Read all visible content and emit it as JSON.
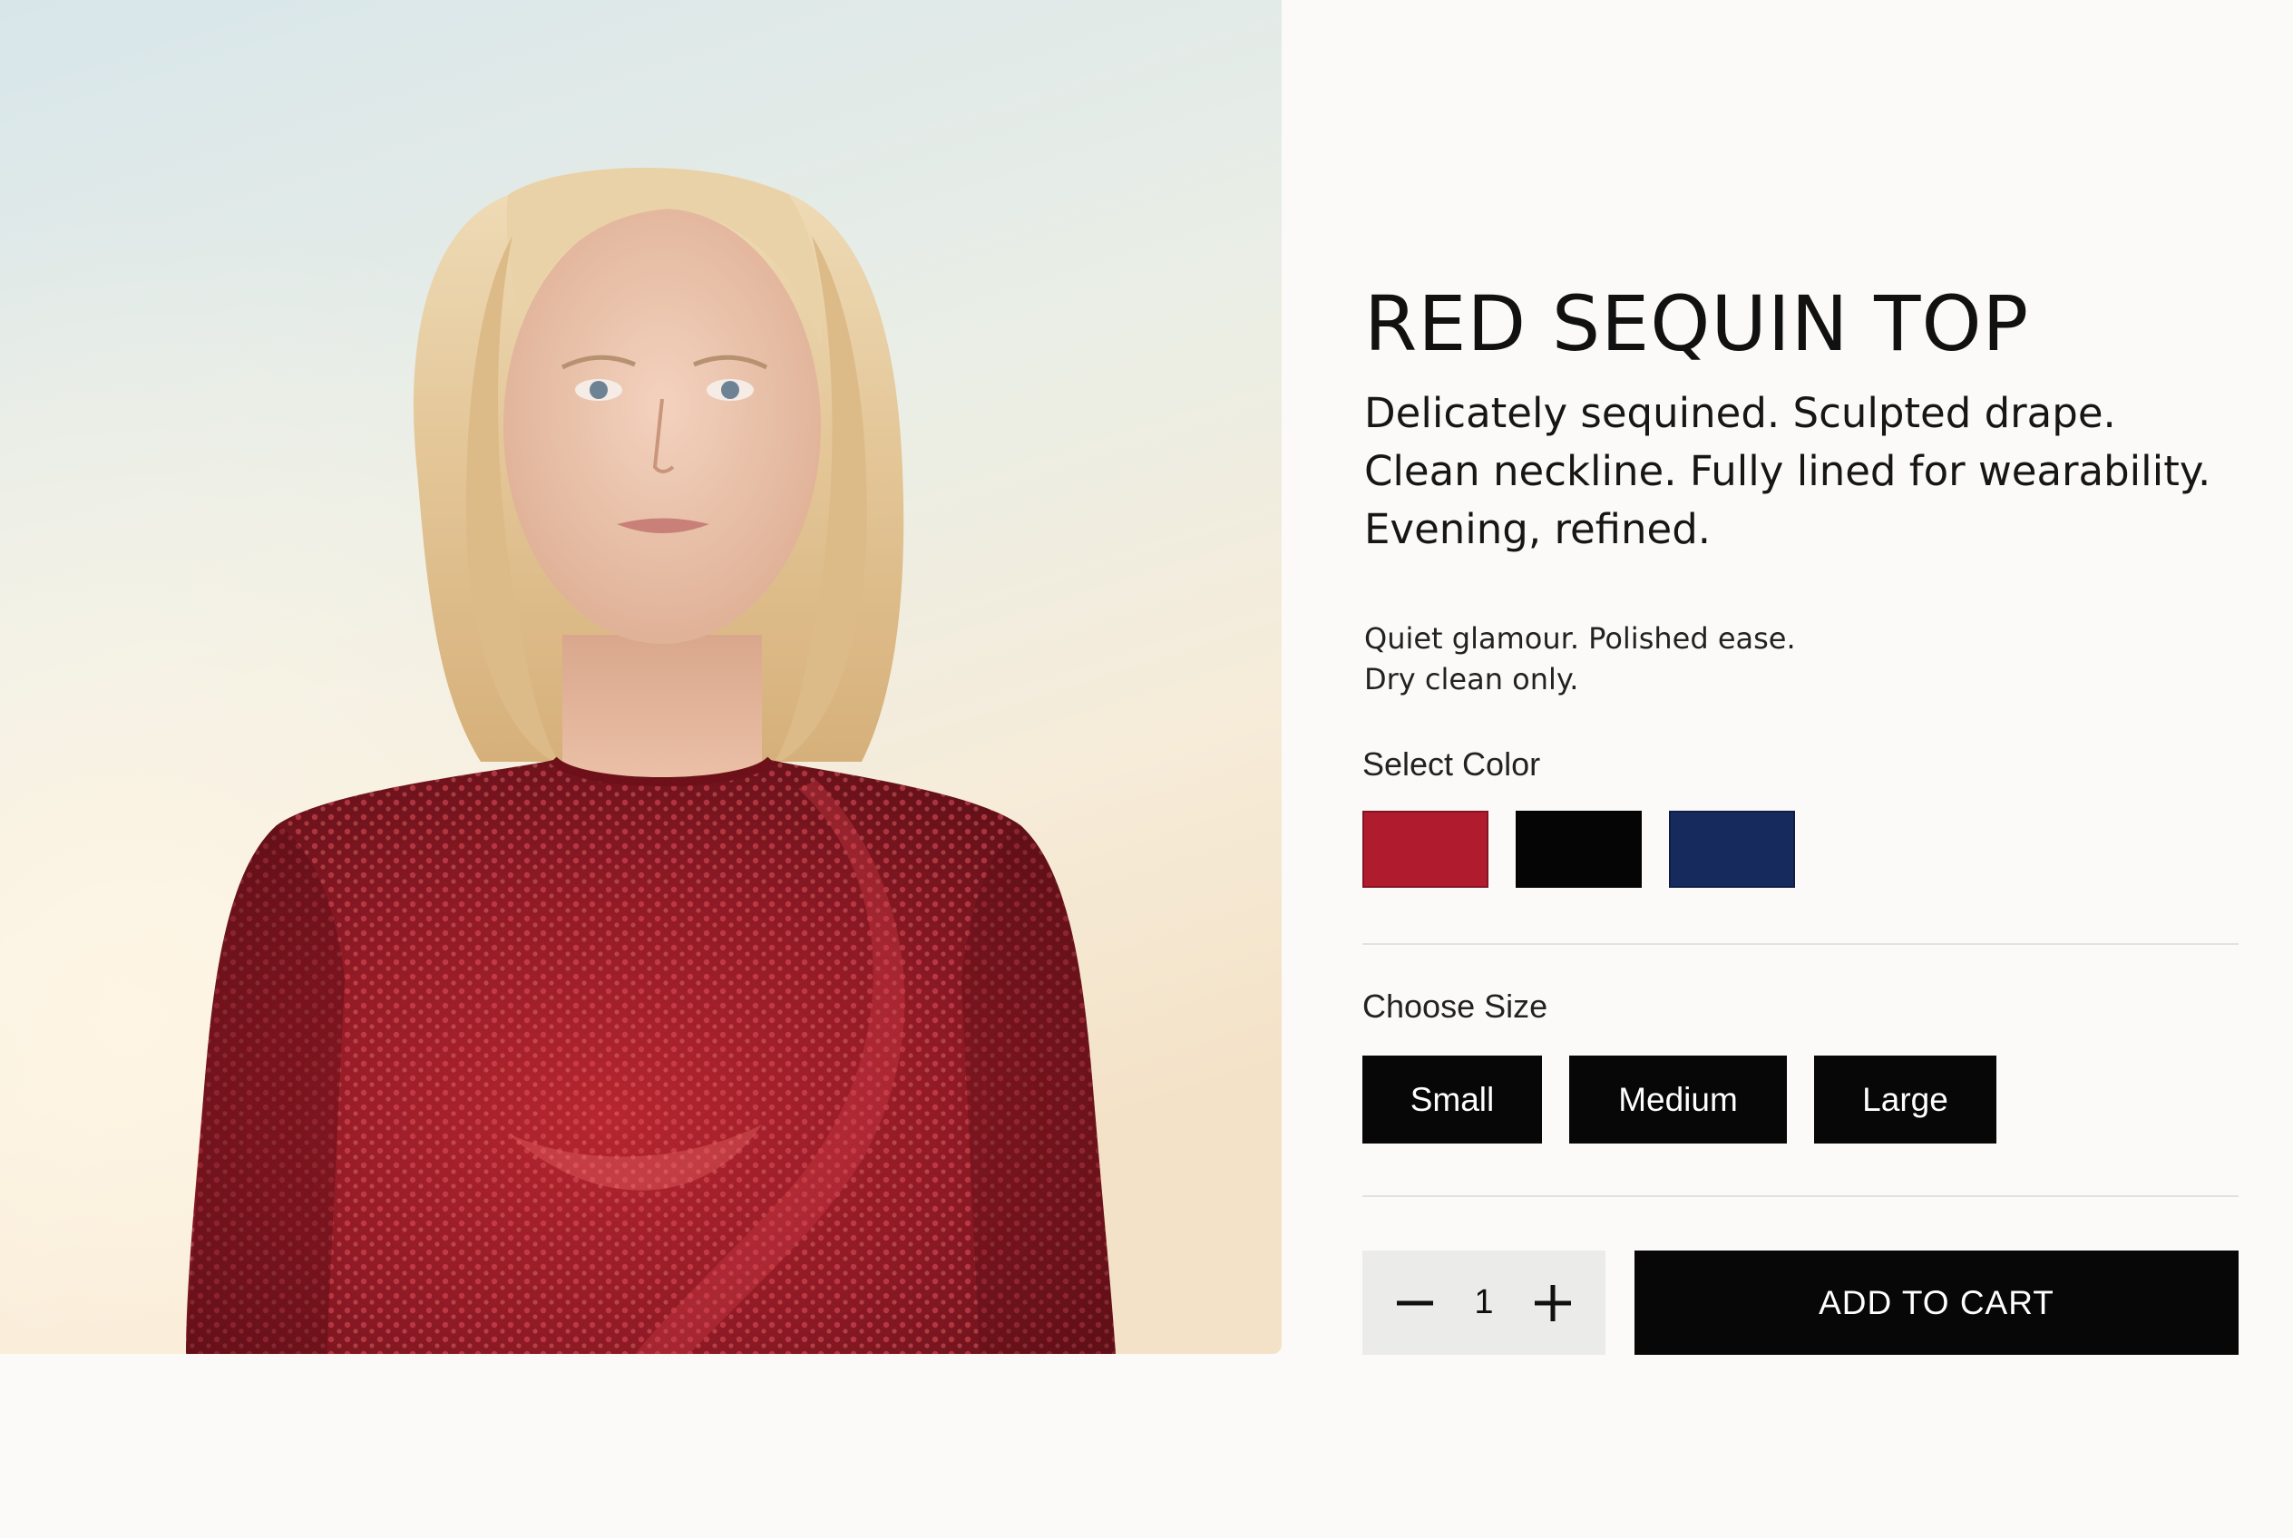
{
  "product": {
    "title": "RED SEQUIN TOP",
    "description": "Delicately sequined. Sculpted drape. Clean neckline. Fully lined for wearability. Evening, refined.",
    "tagline": [
      "Quiet glamour. Polished ease.",
      "Dry clean only."
    ],
    "image_icon": "product-photo"
  },
  "color": {
    "label": "Select Color",
    "options": [
      {
        "name": "red",
        "hex": "#b01c2e"
      },
      {
        "name": "black",
        "hex": "#050505"
      },
      {
        "name": "navy",
        "hex": "#172a5e"
      }
    ]
  },
  "size": {
    "label": "Choose Size",
    "options": [
      "Small",
      "Medium",
      "Large"
    ]
  },
  "cart": {
    "quantity": "1",
    "decrement_icon": "minus-icon",
    "increment_icon": "plus-icon",
    "add_label": "ADD TO CART"
  },
  "colors": {
    "background": "#fbfaf8",
    "button": "#070707",
    "button_text": "#ffffff",
    "quantity_bg": "#ebebea",
    "divider": "#e3e1dd"
  }
}
